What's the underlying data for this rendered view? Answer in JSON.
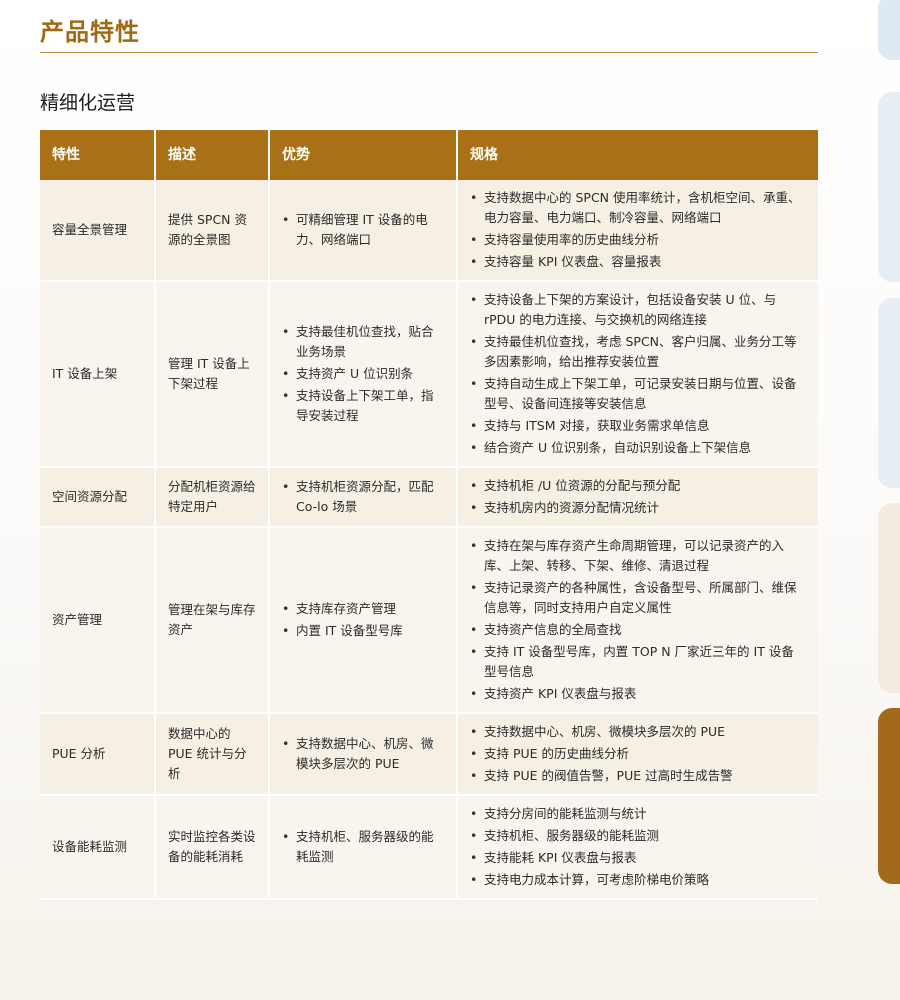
{
  "page": {
    "title": "产品特性",
    "subtitle": "精细化运营"
  },
  "table": {
    "headers": [
      "特性",
      "描述",
      "优势",
      "规格"
    ],
    "rows": [
      {
        "feature": "容量全景管理",
        "description": "提供 SPCN 资源的全景图",
        "advantages": [
          "可精细管理 IT 设备的电力、网络端口"
        ],
        "specs": [
          "支持数据中心的 SPCN 使用率统计，含机柜空间、承重、电力容量、电力端口、制冷容量、网络端口",
          "支持容量使用率的历史曲线分析",
          "支持容量 KPI 仪表盘、容量报表"
        ]
      },
      {
        "feature": "IT 设备上架",
        "description": "管理 IT 设备上下架过程",
        "advantages": [
          "支持最佳机位查找，贴合业务场景",
          "支持资产 U 位识别条",
          "支持设备上下架工单，指导安装过程"
        ],
        "specs": [
          "支持设备上下架的方案设计，包括设备安装 U 位、与 rPDU 的电力连接、与交换机的网络连接",
          "支持最佳机位查找，考虑 SPCN、客户归属、业务分工等多因素影响，给出推荐安装位置",
          "支持自动生成上下架工单，可记录安装日期与位置、设备型号、设备间连接等安装信息",
          "支持与 ITSM 对接，获取业务需求单信息",
          "结合资产 U 位识别条，自动识别设备上下架信息"
        ]
      },
      {
        "feature": "空间资源分配",
        "description": "分配机柜资源给特定用户",
        "advantages": [
          "支持机柜资源分配，匹配 Co-lo 场景"
        ],
        "specs": [
          "支持机柜 /U 位资源的分配与预分配",
          "支持机房内的资源分配情况统计"
        ]
      },
      {
        "feature": "资产管理",
        "description": "管理在架与库存资产",
        "advantages": [
          "支持库存资产管理",
          "内置 IT 设备型号库"
        ],
        "specs": [
          "支持在架与库存资产生命周期管理，可以记录资产的入库、上架、转移、下架、维修、清退过程",
          "支持记录资产的各种属性，含设备型号、所属部门、维保信息等，同时支持用户自定义属性",
          "支持资产信息的全局查找",
          "支持 IT 设备型号库，内置 TOP N 厂家近三年的 IT 设备型号信息",
          "支持资产 KPI 仪表盘与报表"
        ]
      },
      {
        "feature": "PUE 分析",
        "description": "数据中心的 PUE 统计与分析",
        "advantages": [
          "支持数据中心、机房、微模块多层次的 PUE"
        ],
        "specs": [
          "支持数据中心、机房、微模块多层次的 PUE",
          "支持 PUE 的历史曲线分析",
          "支持 PUE 的阀值告警，PUE 过高时生成告警"
        ]
      },
      {
        "feature": "设备能耗监测",
        "description": "实时监控各类设备的能耗消耗",
        "advantages": [
          "支持机柜、服务器级的能耗监测"
        ],
        "specs": [
          "支持分房间的能耗监测与统计",
          "支持机柜、服务器级的能耗监测",
          "支持能耗 KPI 仪表盘与报表",
          "支持电力成本计算，可考虑阶梯电价策略"
        ]
      }
    ]
  }
}
